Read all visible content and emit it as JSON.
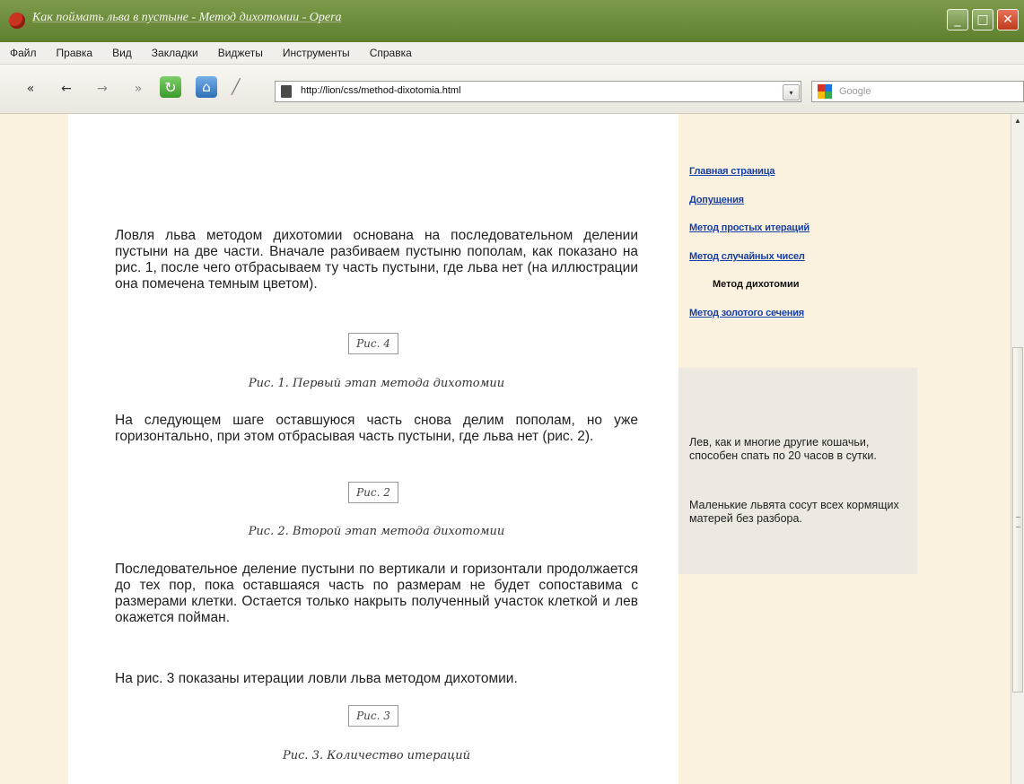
{
  "window": {
    "title": "Как поймать льва в пустыне - Метод дихотомии - Opera",
    "controls": {
      "minimize": "_",
      "maximize": "□",
      "close": "✕"
    }
  },
  "menu": [
    "Файл",
    "Правка",
    "Вид",
    "Закладки",
    "Виджеты",
    "Инструменты",
    "Справка"
  ],
  "toolbar": {
    "icons": {
      "rewind": "«",
      "back": "←",
      "forward": "→",
      "fast_forward": "»",
      "reload": "↻",
      "home": "⌂",
      "wand": "╱"
    },
    "address": "http://lion/css/method-dixotomia.html",
    "search_placeholder": "Google",
    "dropdown": "▾"
  },
  "article": {
    "p1": "Ловля льва методом дихотомии основана на последовательном делении пустыни на две части. Вначале разбиваем пустыню пополам, как показано на рис. 1, после чего отбрасываем ту часть пустыни, где льва нет (на иллюстрации она помечена темным цветом).",
    "fig1_alt": "Рис. 4",
    "cap1": "Рис. 1. Первый этап метода дихотомии",
    "p2": "На следующем шаге оставшуюся часть снова делим пополам, но уже горизонтально, при этом отбрасывая часть пустыни, где льва нет (рис. 2).",
    "fig2_alt": "Рис. 2",
    "cap2": "Рис. 2. Второй этап метода дихотомии",
    "p3": "Последовательное деление пустыни по вертикали и горизонтали продолжается до тех пор, пока оставшаяся часть по размерам не будет сопоставима с размерами клетки. Остается только накрыть полученный участок клеткой и лев окажется пойман.",
    "p4": "На рис. 3 показаны итерации ловли льва методом дихотомии.",
    "fig3_alt": "Рис. 3",
    "cap3": "Рис. 3. Количество итераций"
  },
  "sidebar": {
    "links": [
      "Главная страница",
      "Допущения",
      "Метод простых итераций",
      "Метод случайных чисел"
    ],
    "current": "Метод дихотомии",
    "link_last": "Метод золотого сечения",
    "note1": "Лев, как и многие другие кошачьи, способен спать по 20 часов в сутки.",
    "note2": "Маленькие львята сосут всех кормящих матерей без разбора."
  },
  "colors": {
    "titlebar": "#6b8a3a",
    "page_bg": "#fbf1df",
    "link": "#1740a8",
    "info_box": "#ede9e0"
  }
}
